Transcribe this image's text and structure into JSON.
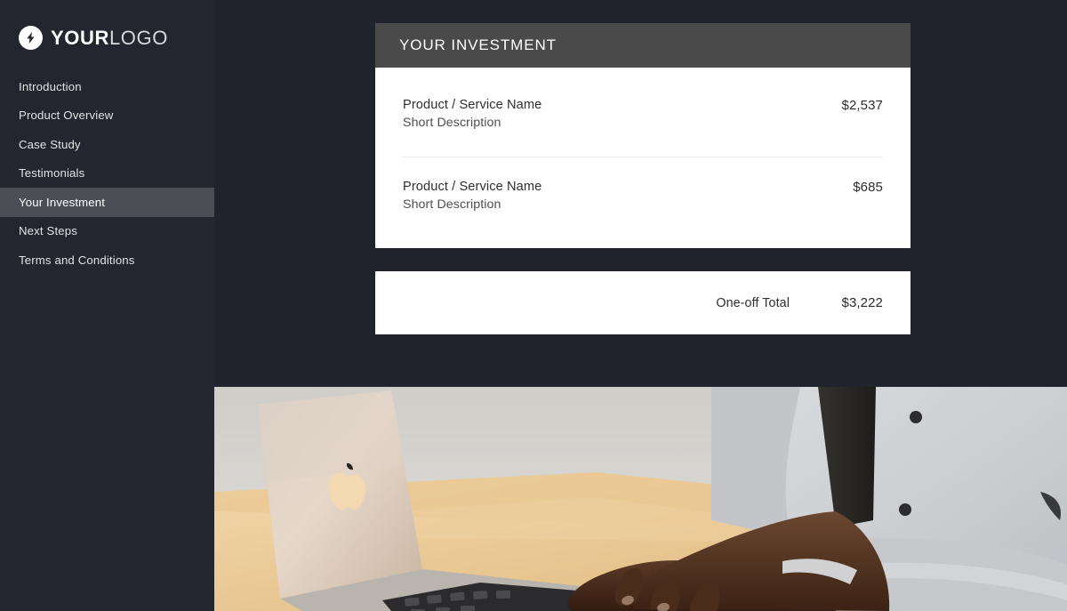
{
  "sidebar": {
    "logo": {
      "icon": "lightning-bolt-icon",
      "text_bold": "YOUR",
      "text_light": "LOGO"
    },
    "items": [
      {
        "label": "Introduction",
        "active": false
      },
      {
        "label": "Product Overview",
        "active": false
      },
      {
        "label": "Case Study",
        "active": false
      },
      {
        "label": "Testimonials",
        "active": false
      },
      {
        "label": "Your Investment",
        "active": true
      },
      {
        "label": "Next Steps",
        "active": false
      },
      {
        "label": "Terms and Conditions",
        "active": false
      }
    ]
  },
  "investment_card": {
    "header_title": "YOUR INVESTMENT",
    "line_items": [
      {
        "name": "Product / Service Name",
        "description": "Short Description",
        "price": "$2,537"
      },
      {
        "name": "Product / Service Name",
        "description": "Short Description",
        "price": "$685"
      }
    ]
  },
  "total_card": {
    "label": "One-off Total",
    "value": "$3,222"
  },
  "hero_photo": {
    "alt": "Person in light gray shirt typing on a rose gold laptop at a wooden desk"
  },
  "colors": {
    "page_background": "#21242d",
    "sidebar_background": "#23262f",
    "sidebar_active": "#4b4e55",
    "card_header": "#4a4a4a",
    "card_background": "#ffffff",
    "text_light": "#e2e3e6",
    "text_dark": "#2f2f2f"
  }
}
